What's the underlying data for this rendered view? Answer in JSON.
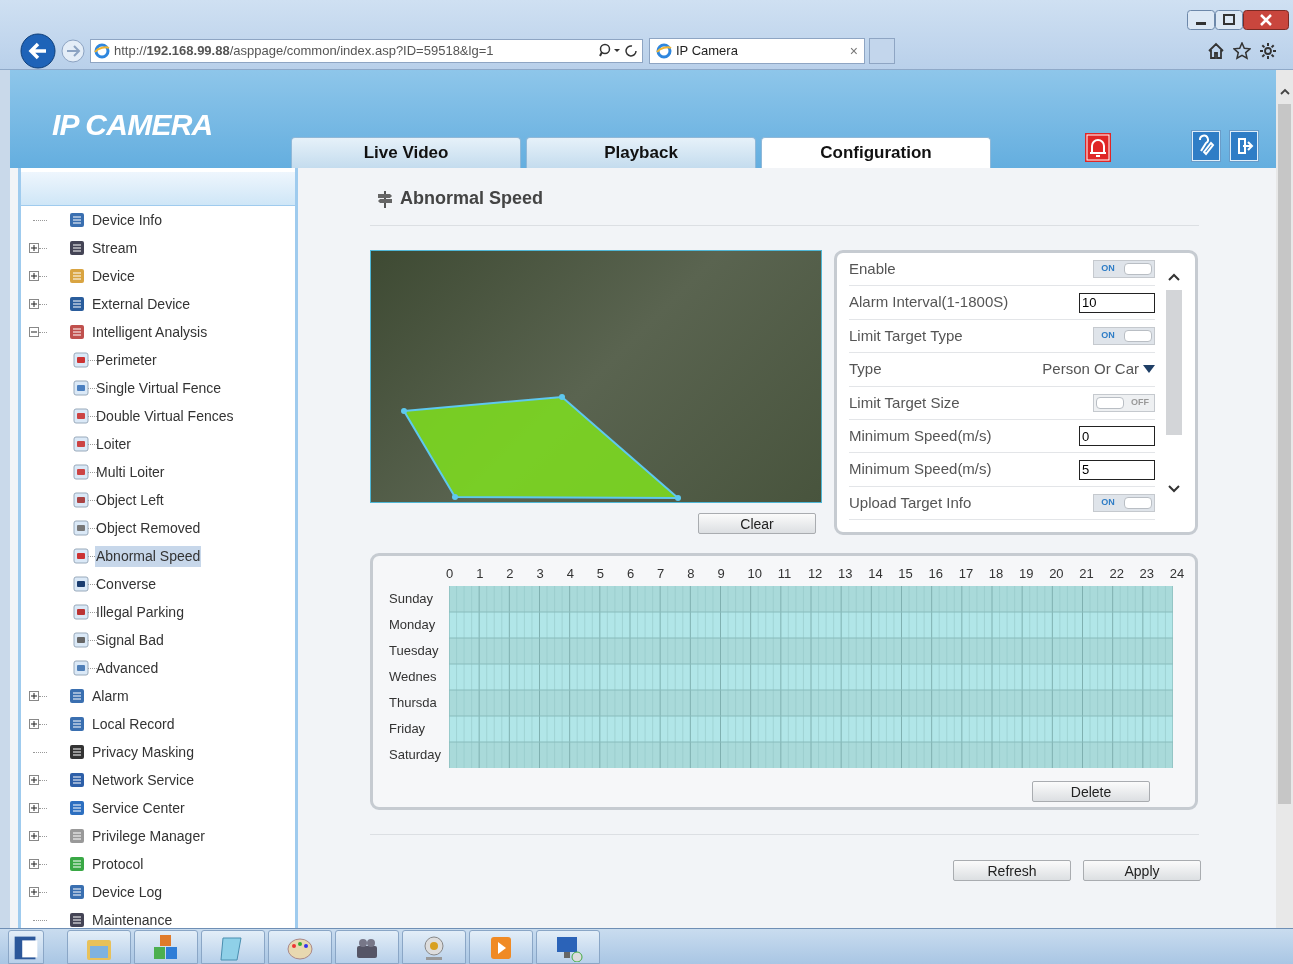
{
  "browser": {
    "url": "http://**192.168.99.88**/asppage/common/index.asp?ID=59518&lg=1",
    "tab_title": "IP Camera",
    "tab_close": "×"
  },
  "header": {
    "logo": "IP CAMERA",
    "tabs": [
      {
        "label": "Live Video",
        "selected": false
      },
      {
        "label": "Playback",
        "selected": false
      },
      {
        "label": "Configuration",
        "selected": true
      }
    ]
  },
  "sidebar": {
    "items": [
      {
        "label": "Device Info",
        "selected": false
      },
      {
        "label": "Stream",
        "expanded": false,
        "selected": false
      },
      {
        "label": "Device",
        "expanded": false,
        "selected": false
      },
      {
        "label": "External Device",
        "expanded": false,
        "selected": false
      },
      {
        "label": "Intelligent Analysis",
        "expanded": true,
        "selected": false,
        "children": [
          {
            "label": "Perimeter",
            "selected": false
          },
          {
            "label": "Single Virtual Fence",
            "selected": false
          },
          {
            "label": "Double Virtual Fences",
            "selected": false
          },
          {
            "label": "Loiter",
            "selected": false
          },
          {
            "label": "Multi Loiter",
            "selected": false
          },
          {
            "label": "Object Left",
            "selected": false
          },
          {
            "label": "Object Removed",
            "selected": false
          },
          {
            "label": "Abnormal Speed",
            "selected": true
          },
          {
            "label": "Converse",
            "selected": false
          },
          {
            "label": "Illegal Parking",
            "selected": false
          },
          {
            "label": "Signal Bad",
            "selected": false
          },
          {
            "label": "Advanced",
            "selected": false
          }
        ]
      },
      {
        "label": "Alarm",
        "expanded": false,
        "selected": false
      },
      {
        "label": "Local Record",
        "expanded": false,
        "selected": false
      },
      {
        "label": "Privacy Masking",
        "selected": false
      },
      {
        "label": "Network Service",
        "expanded": false,
        "selected": false
      },
      {
        "label": "Service Center",
        "expanded": false,
        "selected": false
      },
      {
        "label": "Privilege Manager",
        "expanded": false,
        "selected": false
      },
      {
        "label": "Protocol",
        "expanded": false,
        "selected": false
      },
      {
        "label": "Device Log",
        "expanded": false,
        "selected": false
      },
      {
        "label": "Maintenance",
        "selected": false
      }
    ]
  },
  "page_title": "Abnormal Speed",
  "clear_button": "Clear",
  "settings": [
    {
      "kind": "toggle",
      "label": "Enable",
      "on": true,
      "switch_text": "ON"
    },
    {
      "kind": "input",
      "label": "Alarm Interval(1-1800S)",
      "value": "10"
    },
    {
      "kind": "toggle",
      "label": "Limit Target Type",
      "on": true,
      "switch_text": "ON"
    },
    {
      "kind": "select",
      "label": "Type",
      "value": "Person Or Car"
    },
    {
      "kind": "toggle",
      "label": "Limit Target Size",
      "on": false,
      "switch_text": "OFF"
    },
    {
      "kind": "input",
      "label": "Minimum Speed(m/s)",
      "value": "0"
    },
    {
      "kind": "input",
      "label": "Minimum Speed(m/s)",
      "value": "5"
    },
    {
      "kind": "toggle",
      "label": "Upload Target Info",
      "on": true,
      "switch_text": "ON"
    }
  ],
  "schedule": {
    "hours": [
      "0",
      "1",
      "2",
      "3",
      "4",
      "5",
      "6",
      "7",
      "8",
      "9",
      "10",
      "11",
      "12",
      "13",
      "14",
      "15",
      "16",
      "17",
      "18",
      "19",
      "20",
      "21",
      "22",
      "23",
      "24"
    ],
    "days": [
      "Sunday",
      "Monday",
      "Tuesday",
      "Wednes",
      "Thursda",
      "Friday",
      "Saturday"
    ],
    "delete_button": "Delete"
  },
  "footer_buttons": [
    "Refresh",
    "Apply"
  ]
}
